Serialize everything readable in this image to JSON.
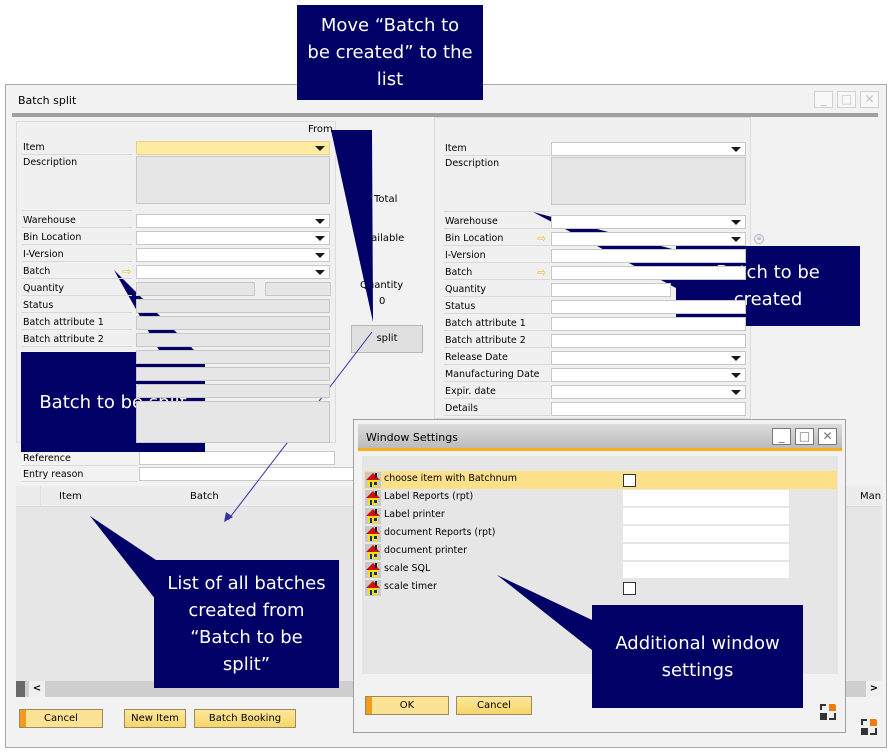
{
  "main_window": {
    "title": "Batch split",
    "controls": {
      "minimize": "_",
      "maximize": "□",
      "close": "✕"
    },
    "from_panel": {
      "header": "From",
      "fields": [
        {
          "label": "Item",
          "type": "dropdown",
          "value": "",
          "highlighted": true
        },
        {
          "label": "Description",
          "type": "textarea",
          "value": ""
        },
        {
          "label": "Warehouse",
          "type": "dropdown",
          "value": ""
        },
        {
          "label": "Bin Location",
          "type": "dropdown",
          "value": ""
        },
        {
          "label": "I-Version",
          "type": "dropdown",
          "value": ""
        },
        {
          "label": "Batch",
          "type": "dropdown",
          "value": "",
          "link_arrow": true
        },
        {
          "label": "Quantity",
          "type": "readonly",
          "value": ""
        },
        {
          "label": "Status",
          "type": "readonly",
          "value": ""
        },
        {
          "label": "Batch attribute 1",
          "type": "readonly",
          "value": ""
        },
        {
          "label": "Batch attribute 2",
          "type": "readonly",
          "value": ""
        }
      ],
      "reference_label": "Reference",
      "entry_reason_label": "Entry reason"
    },
    "middle": {
      "total_label": "Total",
      "available_label": "Available",
      "quantity_label": "Quantity",
      "quantity_value": "0",
      "split_button": "split"
    },
    "to_panel": {
      "fields": [
        {
          "label": "Item",
          "type": "dropdown",
          "value": ""
        },
        {
          "label": "Description",
          "type": "textarea",
          "value": ""
        },
        {
          "label": "Warehouse",
          "type": "dropdown",
          "value": ""
        },
        {
          "label": "Bin Location",
          "type": "dropdown",
          "value": "",
          "link_arrow": true
        },
        {
          "label": "I-Version",
          "type": "text",
          "value": ""
        },
        {
          "label": "Batch",
          "type": "text",
          "value": "",
          "link_arrow": true
        },
        {
          "label": "Quantity",
          "type": "text",
          "value": ""
        },
        {
          "label": "Status",
          "type": "text",
          "value": ""
        },
        {
          "label": "Batch attribute 1",
          "type": "text",
          "value": ""
        },
        {
          "label": "Batch attribute 2",
          "type": "text",
          "value": ""
        },
        {
          "label": "Release Date",
          "type": "dropdown",
          "value": ""
        },
        {
          "label": "Manufacturing Date",
          "type": "dropdown",
          "value": ""
        },
        {
          "label": "Expir. date",
          "type": "dropdown",
          "value": ""
        },
        {
          "label": "Details",
          "type": "text",
          "value": ""
        }
      ]
    },
    "grid": {
      "columns": [
        "",
        "Item",
        "Batch",
        "Man"
      ],
      "rows": []
    },
    "scroll_left": "<",
    "scroll_right": ">",
    "buttons": {
      "cancel": "Cancel",
      "new_item": "New Item",
      "batch_booking": "Batch Booking"
    }
  },
  "settings_window": {
    "title": "Window Settings",
    "rows": [
      {
        "label": "choose item with Batchnum",
        "type": "checkbox",
        "checked": false,
        "highlighted": true
      },
      {
        "label": "Label Reports (rpt)",
        "type": "text",
        "value": ""
      },
      {
        "label": "Label printer",
        "type": "text",
        "value": ""
      },
      {
        "label": "document Reports (rpt)",
        "type": "text",
        "value": ""
      },
      {
        "label": "document printer",
        "type": "text",
        "value": ""
      },
      {
        "label": "scale SQL",
        "type": "text",
        "value": ""
      },
      {
        "label": "scale timer",
        "type": "checkbox",
        "checked": false
      }
    ],
    "buttons": {
      "ok": "OK",
      "cancel": "Cancel"
    }
  },
  "callouts": {
    "move_to_list": "Move “Batch to be created” to the list",
    "batch_to_be_created": "Batch to be created",
    "batch_to_be_split": "Batch to be split",
    "list_of_batches": "List of all batches created from “Batch to be split”",
    "additional_settings": "Additional window settings"
  },
  "colors": {
    "callout_bg": "#000066",
    "highlight_yellow": "#fde08a",
    "accent_orange": "#f5b01e"
  }
}
